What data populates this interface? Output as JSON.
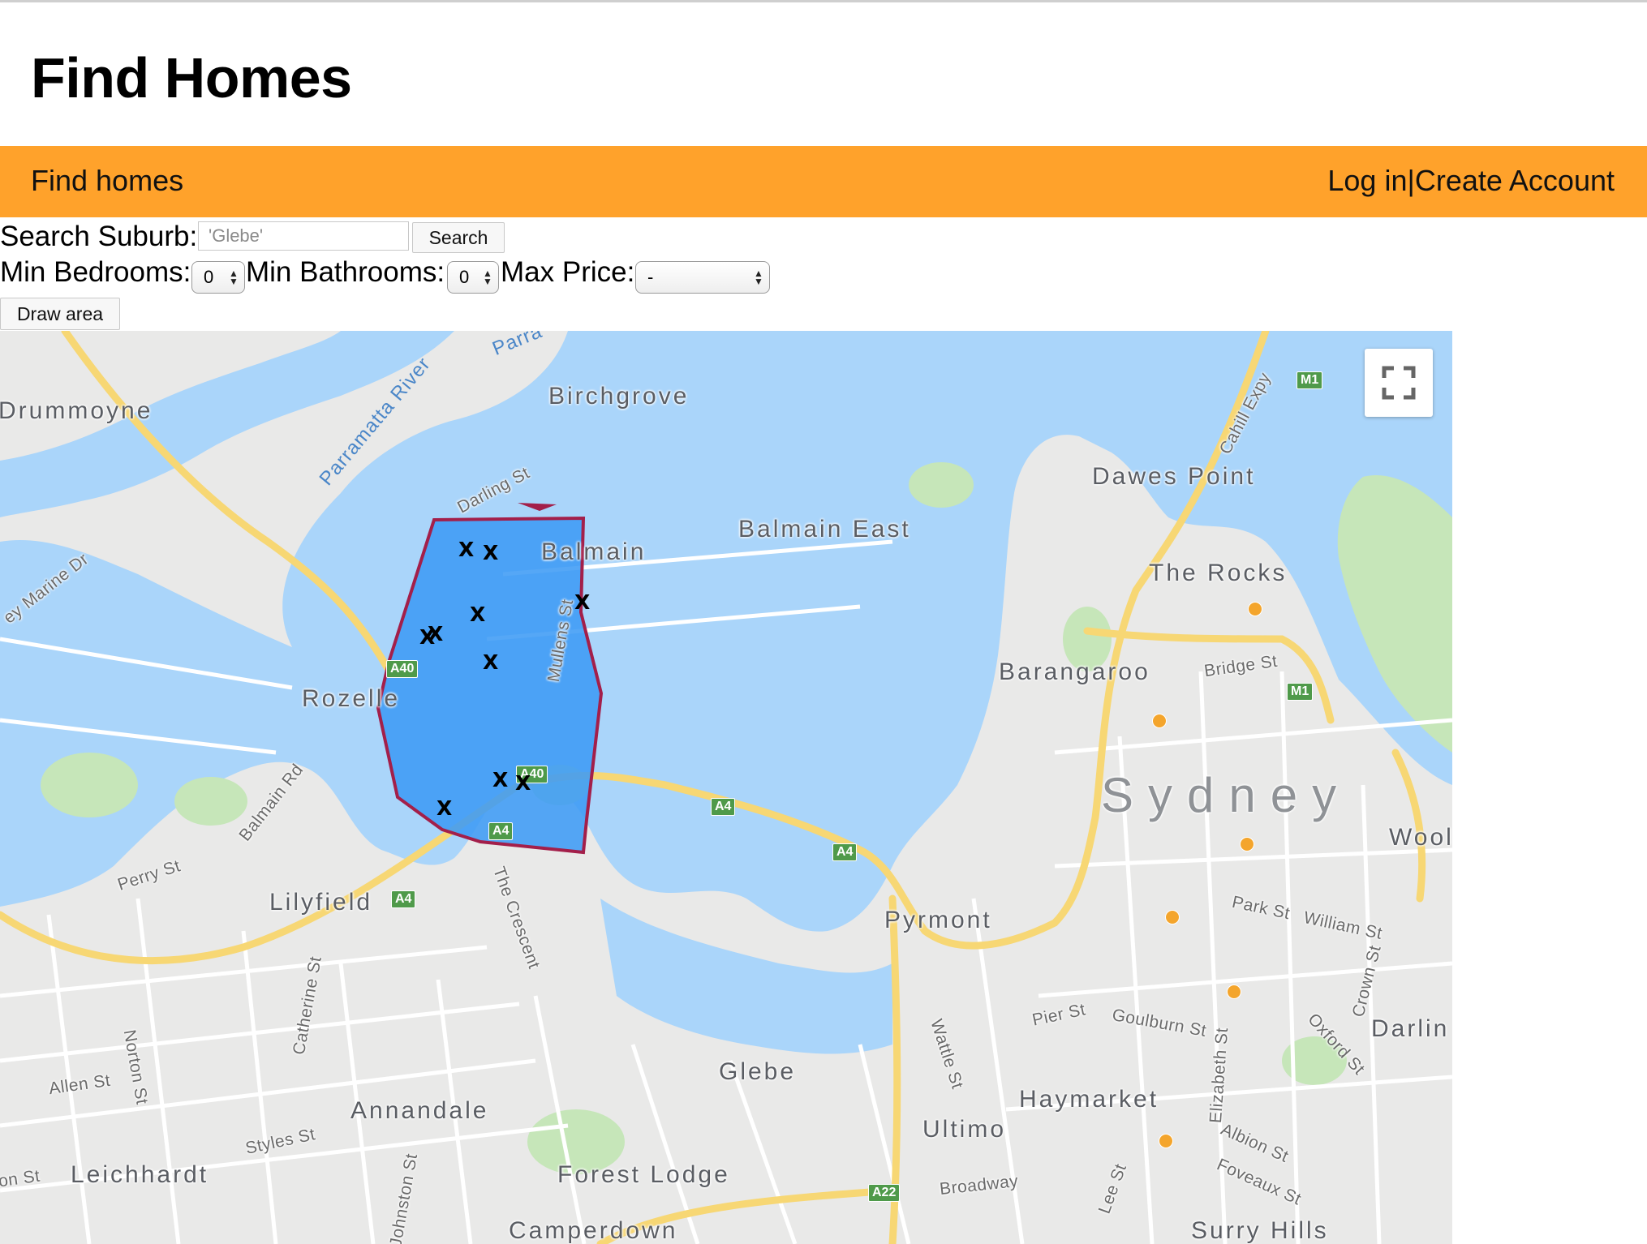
{
  "header": {
    "title": "Find Homes"
  },
  "nav": {
    "find_homes": "Find homes",
    "login": "Log in",
    "separator": "|",
    "create_account": "Create Account",
    "bar_color": "#ffa22b"
  },
  "search": {
    "label": "Search Suburb:",
    "placeholder": "'Glebe'",
    "button": "Search"
  },
  "filters": {
    "min_bedrooms_label": "Min Bedrooms:",
    "min_bedrooms_value": "0",
    "min_bathrooms_label": "Min Bathrooms:",
    "min_bathrooms_value": "0",
    "max_price_label": "Max Price:",
    "max_price_value": "-"
  },
  "draw_area_button": "Draw area",
  "map": {
    "fullscreen_icon": "fullscreen-icon",
    "suburbs": {
      "drummoyne": "Drummoyne",
      "birchgrove": "Birchgrove",
      "balmain": "Balmain",
      "balmain_east": "Balmain East",
      "dawes_point": "Dawes Point",
      "the_rocks": "The Rocks",
      "barangaroo": "Barangaroo",
      "rozelle": "Rozelle",
      "sydney": "Sydney",
      "lilyfield": "Lilyfield",
      "pyrmont": "Pyrmont",
      "glebe": "Glebe",
      "annandale": "Annandale",
      "haymarket": "Haymarket",
      "ultimo": "Ultimo",
      "leichhardt": "Leichhardt",
      "forest_lodge": "Forest Lodge",
      "camperdown": "Camperdown",
      "surry_hills": "Surry Hills",
      "wool": "Wool",
      "darlin": "Darlin"
    },
    "streets": {
      "darling_st": "Darling St",
      "mullens_st": "Mullens St",
      "cahill_expy": "Cahill Expy",
      "bridge_st": "Bridge St",
      "balmain_rd": "Balmain Rd",
      "perry_st": "Perry St",
      "the_crescent": "The Crescent",
      "park_st": "Park St",
      "william_st": "William St",
      "catherine_st": "Catherine St",
      "pier_st": "Pier St",
      "goulburn_st": "Goulburn St",
      "wattle_st": "Wattle St",
      "elizabeth_st": "Elizabeth St",
      "crown_st": "Crown St",
      "oxford_st": "Oxford St",
      "norton_st": "Norton St",
      "allen_st": "Allen St",
      "styles_st": "Styles St",
      "johnston_st": "Johnston St",
      "albion_st": "Albion St",
      "foveaux_st": "Foveaux St",
      "broadway": "Broadway",
      "lee_st": "Lee St",
      "on_st": "on St",
      "marine_dr": "ey Marine Dr",
      "parra": "Parra",
      "parramatta_river": "Parramatta River"
    },
    "shields": {
      "m1": "M1",
      "a40": "A40",
      "a4": "A4",
      "a22": "A22"
    },
    "marker_label": "X",
    "polygon_fill": "#3d9bf5",
    "polygon_stroke": "#a31f4a",
    "water_color": "#aad5fa"
  }
}
